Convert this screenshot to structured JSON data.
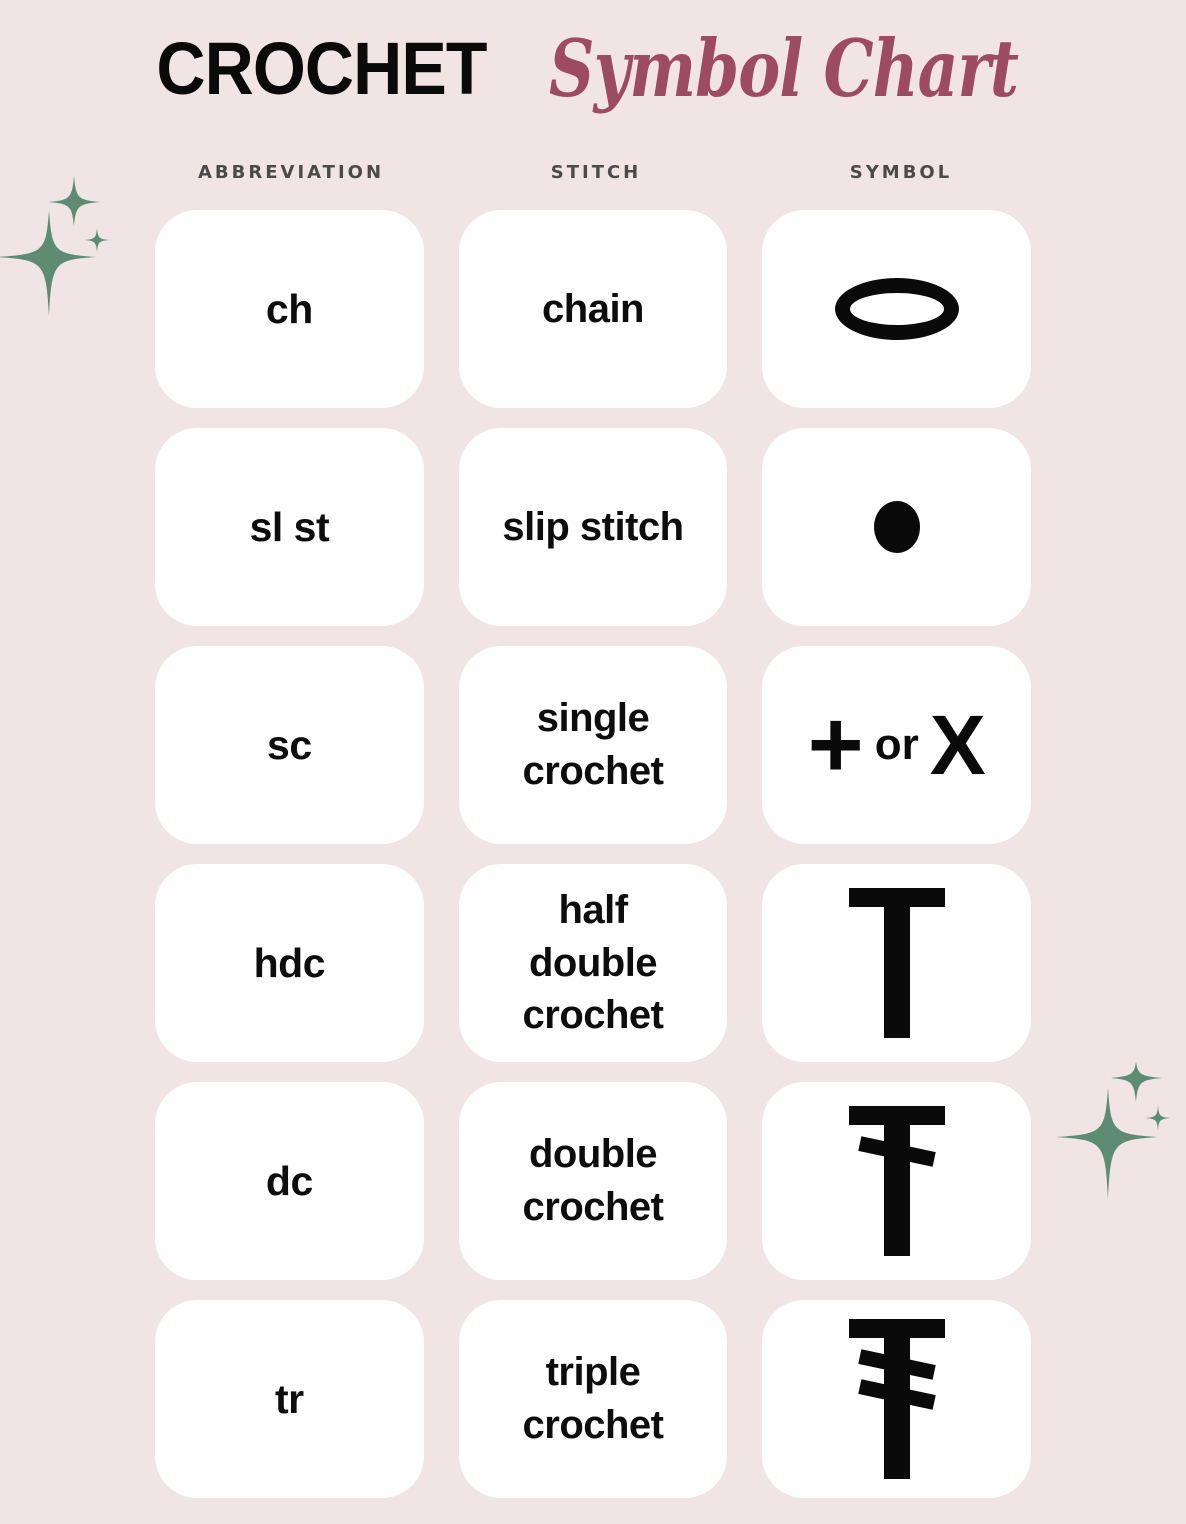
{
  "title": {
    "bold_part": "CROCHET",
    "script_part": "Symbol Chart"
  },
  "colors": {
    "background": "#F0E4E4",
    "card": "#FFFEFE",
    "title_bold": "#0A0A0A",
    "title_script": "#9D4B63",
    "header_text": "#4A4A4A",
    "body_text": "#0D0D0D",
    "sparkle_green": "#5E8C73"
  },
  "headers": [
    {
      "label": "ABBREVIATION"
    },
    {
      "label": "STITCH"
    },
    {
      "label": "SYMBOL"
    }
  ],
  "rows": [
    {
      "abbreviation": "ch",
      "stitch": "chain",
      "symbol_name": "oval-ring-symbol",
      "symbol_type": "oval"
    },
    {
      "abbreviation": "sl st",
      "stitch": "slip stitch",
      "symbol_name": "filled-dot-symbol",
      "symbol_type": "dot"
    },
    {
      "abbreviation": "sc",
      "stitch": "single\ncrochet",
      "stitch_lines": [
        "single",
        "crochet"
      ],
      "symbol_name": "plus-or-x-symbol",
      "symbol_type": "plus-or-x",
      "symbol_plus": "+",
      "symbol_or": "or",
      "symbol_x": "X"
    },
    {
      "abbreviation": "hdc",
      "stitch": "half\ndouble\ncrochet",
      "stitch_lines": [
        "half",
        "double",
        "crochet"
      ],
      "symbol_name": "t-bar-symbol",
      "symbol_type": "t0"
    },
    {
      "abbreviation": "dc",
      "stitch": "double\ncrochet",
      "stitch_lines": [
        "double",
        "crochet"
      ],
      "symbol_name": "t-bar-one-slash-symbol",
      "symbol_type": "t1"
    },
    {
      "abbreviation": "tr",
      "stitch": "triple\ncrochet",
      "stitch_lines": [
        "triple",
        "crochet"
      ],
      "symbol_name": "t-bar-two-slash-symbol",
      "symbol_type": "t2"
    }
  ],
  "decorations": [
    {
      "name": "sparkle-cluster-left",
      "position": "top-left"
    },
    {
      "name": "sparkle-cluster-right",
      "position": "bottom-right"
    }
  ]
}
